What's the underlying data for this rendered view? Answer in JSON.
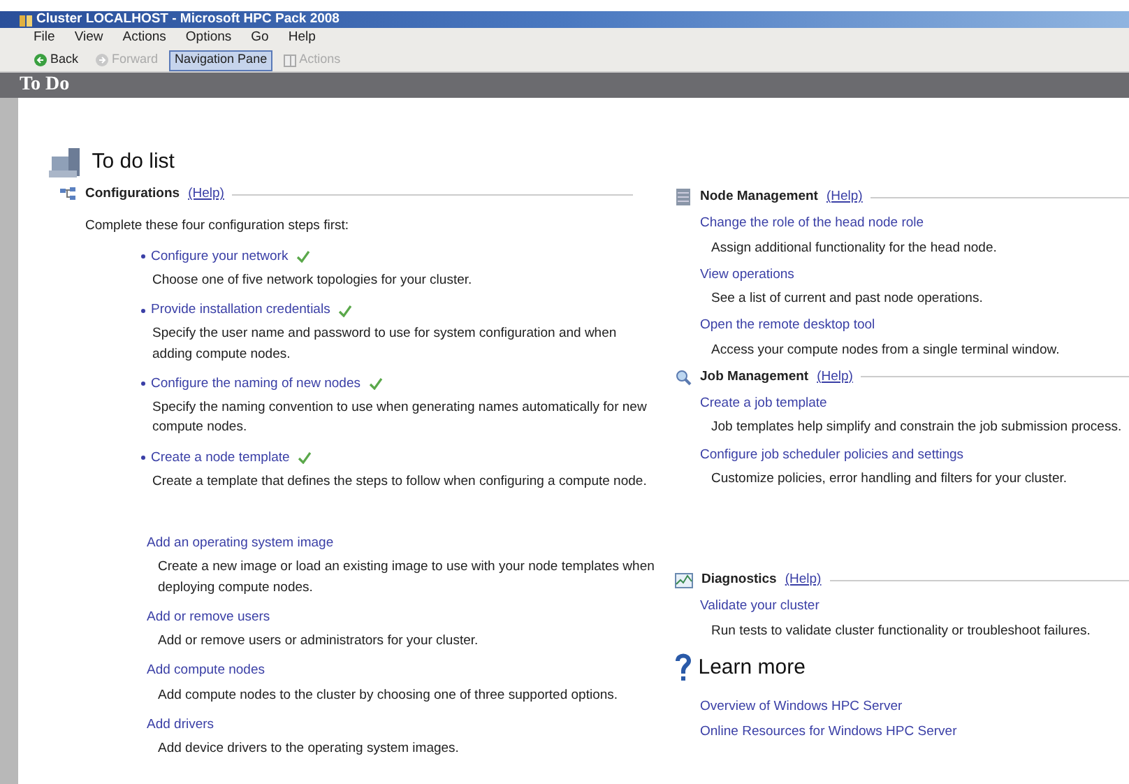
{
  "window": {
    "title": "Cluster LOCALHOST - Microsoft HPC Pack 2008"
  },
  "menu": [
    "File",
    "View",
    "Actions",
    "Options",
    "Go",
    "Help"
  ],
  "toolbar": [
    {
      "kind": "back",
      "label": "Back",
      "disabled": false,
      "selected": false
    },
    {
      "kind": "forward",
      "label": "Forward",
      "disabled": true,
      "selected": false
    },
    {
      "kind": "plain",
      "label": "Navigation Pane",
      "disabled": false,
      "selected": true
    },
    {
      "kind": "actions",
      "label": "Actions",
      "disabled": true,
      "selected": false
    }
  ],
  "page_header": "To Do",
  "todo_title": "To do list",
  "configurations": {
    "title": "Configurations",
    "help": "(Help)",
    "intro": "Complete these four configuration steps first:",
    "steps": [
      {
        "label": "Configure your network",
        "done": true,
        "description": "Choose one of five network topologies for your cluster."
      },
      {
        "label": "Provide installation credentials",
        "done": true,
        "description": "Specify the user name and password to use for system configuration and when adding compute nodes."
      },
      {
        "label": "Configure the naming of new nodes",
        "done": true,
        "description": "Specify the naming convention to use when generating names automatically for new compute nodes."
      },
      {
        "label": "Create a node template",
        "done": true,
        "description": "Create a template that defines the steps to follow when configuring a compute node."
      }
    ],
    "tasks": [
      {
        "label": "Add an operating system image",
        "description": "Create a new image or load an existing image to use with your node templates when deploying compute nodes."
      },
      {
        "label": "Add or remove users",
        "description": "Add or remove users or administrators for your cluster."
      },
      {
        "label": "Add compute nodes",
        "description": "Add compute nodes to the cluster by choosing one of three supported options."
      },
      {
        "label": "Add drivers",
        "description": "Add device drivers to the operating system images."
      }
    ]
  },
  "sections": [
    {
      "kind": "nodes",
      "title": "Node Management",
      "help": "(Help)",
      "items": [
        {
          "label": "Change the role of the head node role",
          "description": "Assign additional functionality for the head node."
        },
        {
          "label": "View operations",
          "description": "See a list of current and past node operations."
        },
        {
          "label": "Open the remote desktop tool",
          "description": "Access your compute nodes from a single terminal window."
        }
      ]
    },
    {
      "kind": "jobs",
      "title": "Job Management",
      "help": "(Help)",
      "items": [
        {
          "label": "Create a job template",
          "description": "Job templates help simplify and constrain the job submission process."
        },
        {
          "label": "Configure job scheduler policies and settings",
          "description": "Customize policies, error handling and filters for your cluster."
        }
      ]
    },
    {
      "kind": "diagnostics",
      "title": "Diagnostics",
      "help": "(Help)",
      "items": [
        {
          "label": "Validate your cluster",
          "description": "Run tests to validate cluster functionality or troubleshoot failures."
        }
      ]
    }
  ],
  "learn_more": {
    "title": "Learn more",
    "links": [
      "Overview of Windows HPC Server",
      "Online Resources for Windows HPC Server"
    ]
  }
}
